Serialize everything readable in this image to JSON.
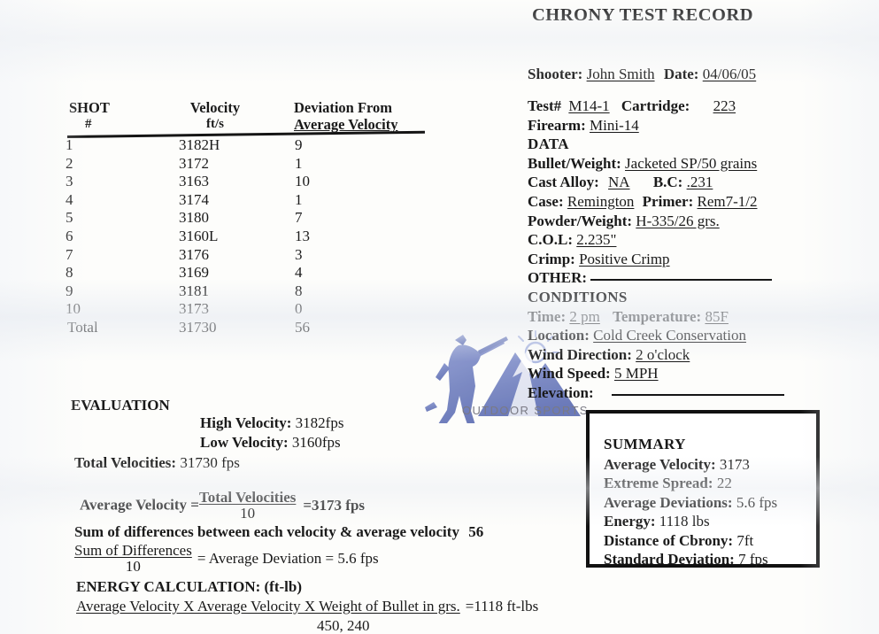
{
  "title": "CHRONY TEST RECORD",
  "shot_table": {
    "headers": {
      "shot": "SHOT",
      "hash": "#",
      "velocity": "Velocity",
      "velocity_units": "ft/s",
      "deviation_line1": "Deviation From",
      "deviation_line2": "Average Velocity"
    },
    "rows": [
      {
        "no": "1",
        "velocity": "3182H",
        "deviation": "9"
      },
      {
        "no": "2",
        "velocity": "3172",
        "deviation": "1"
      },
      {
        "no": "3",
        "velocity": "3163",
        "deviation": "10"
      },
      {
        "no": "4",
        "velocity": "3174",
        "deviation": "1"
      },
      {
        "no": "5",
        "velocity": "3180",
        "deviation": "7"
      },
      {
        "no": "6",
        "velocity": "3160L",
        "deviation": "13"
      },
      {
        "no": "7",
        "velocity": "3176",
        "deviation": "3"
      },
      {
        "no": "8",
        "velocity": "3169",
        "deviation": "4"
      },
      {
        "no": "9",
        "velocity": "3181",
        "deviation": "8"
      },
      {
        "no": "10",
        "velocity": "3173",
        "deviation": "0"
      }
    ],
    "total": {
      "no": "Total",
      "velocity": "31730",
      "deviation": "56"
    }
  },
  "header_fields": {
    "shooter_label": "Shooter:",
    "shooter_value": "John Smith",
    "date_label": "Date:",
    "date_value": "04/06/05",
    "test_label": "Test#",
    "test_value": "M14-1",
    "cartridge_label": "Cartridge:",
    "cartridge_value": "223",
    "firearm_label": "Firearm:",
    "firearm_value": "Mini-14"
  },
  "data_section": {
    "heading": "DATA",
    "bullet_label": "Bullet/Weight:",
    "bullet_value": "Jacketed SP/50 grains",
    "cast_alloy_label": "Cast Alloy:",
    "cast_alloy_value": "NA",
    "bc_label": "B.C:",
    "bc_value": ".231",
    "case_label": "Case:",
    "case_value": "Remington",
    "primer_label": "Primer:",
    "primer_value": "Rem7-1/2",
    "powder_label": "Powder/Weight:",
    "powder_value": "H-335/26 grs.",
    "col_label": "C.O.L:",
    "col_value": "2.235\"",
    "crimp_label": "Crimp:",
    "crimp_value": "Positive Crimp",
    "other_label": "OTHER:",
    "other_value": ""
  },
  "conditions_section": {
    "heading": "CONDITIONS",
    "time_label": "Time:",
    "time_value": "2 pm",
    "temperature_label": "Temperature:",
    "temperature_value": "85F",
    "location_label": "Location:",
    "location_value": "Cold Creek Conservation",
    "wind_direction_label": "Wind Direction:",
    "wind_direction_value": "2 o'clock",
    "wind_speed_label": "Wind Speed:",
    "wind_speed_value": "5 MPH",
    "elevation_label": "Elevation:",
    "elevation_value": ""
  },
  "evaluation": {
    "heading": "EVALUATION",
    "high_velocity_label": "High Velocity:",
    "high_velocity_value": "3182fps",
    "low_velocity_label": "Low Velocity:",
    "low_velocity_value": "3160fps",
    "total_velocities_label": "Total Velocities:",
    "total_velocities_value": "31730 fps",
    "avg_velocity_label": "Average Velocity =",
    "avg_velocity_numerator": "Total Velocities",
    "avg_velocity_denominator": "10",
    "avg_velocity_result": "=3173 fps",
    "sum_diff_sentence": "Sum of differences between each velocity & average velocity",
    "sum_diff_value": "56",
    "avg_dev_numerator": "Sum of Differences",
    "avg_dev_denominator": "10",
    "avg_dev_equals": "= Average Deviation = 5.6 fps",
    "energy_heading": "ENERGY CALCULATION: (ft-lb)",
    "energy_numerator": "Average Velocity X Average Velocity X Weight of Bullet in grs.",
    "energy_denominator": "450, 240",
    "energy_result": "=1118 ft-lbs"
  },
  "summary": {
    "title": "SUMMARY",
    "rows": [
      {
        "label": "Average Velocity:",
        "value": "3173"
      },
      {
        "label": "Extreme Spread:",
        "value": "22"
      },
      {
        "label": "Average Deviations:",
        "value": "5.6 fps"
      },
      {
        "label": "Energy:",
        "value": "1118 lbs"
      },
      {
        "label": "Distance of Cbrony:",
        "value": "7ft"
      },
      {
        "label": "Standard Deviation:",
        "value": "7 fps"
      }
    ]
  },
  "watermark": {
    "text": "OUTDOOR SPORTS",
    "color": "#7b8ac4"
  }
}
